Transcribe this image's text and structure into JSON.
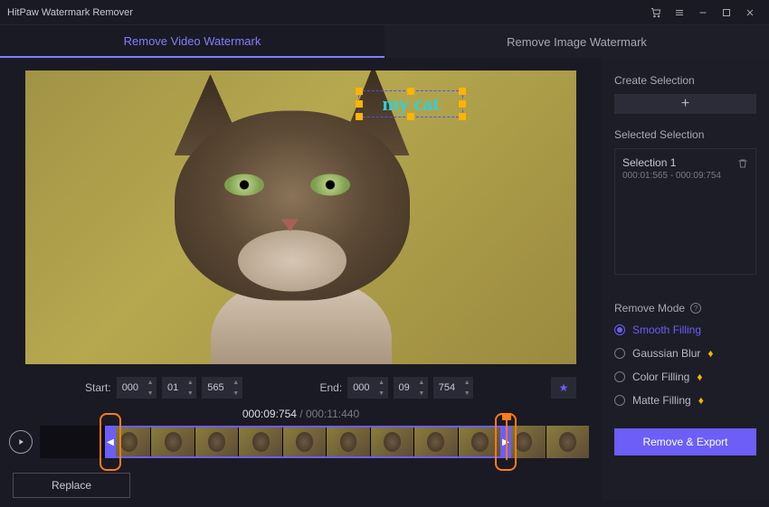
{
  "titlebar": {
    "title": "HitPaw Watermark Remover"
  },
  "tabs": {
    "video": "Remove Video Watermark",
    "image": "Remove Image Watermark"
  },
  "watermark": {
    "text": "my cat"
  },
  "time": {
    "start_label": "Start:",
    "end_label": "End:",
    "start_hh": "000",
    "start_mm": "01",
    "start_ms": "565",
    "end_hh": "000",
    "end_mm": "09",
    "end_ms": "754"
  },
  "timecode": {
    "current": "000:09:754",
    "separator": " / ",
    "total": "000:11:440"
  },
  "buttons": {
    "replace": "Replace",
    "export": "Remove & Export",
    "add": "+"
  },
  "right": {
    "create_label": "Create Selection",
    "selected_label": "Selected Selection",
    "selection_name": "Selection 1",
    "selection_time": "000:01:565 - 000:09:754",
    "mode_label": "Remove Mode",
    "modes": {
      "smooth": "Smooth Filling",
      "gaussian": "Gaussian Blur",
      "color": "Color Filling",
      "matte": "Matte Filling"
    }
  }
}
